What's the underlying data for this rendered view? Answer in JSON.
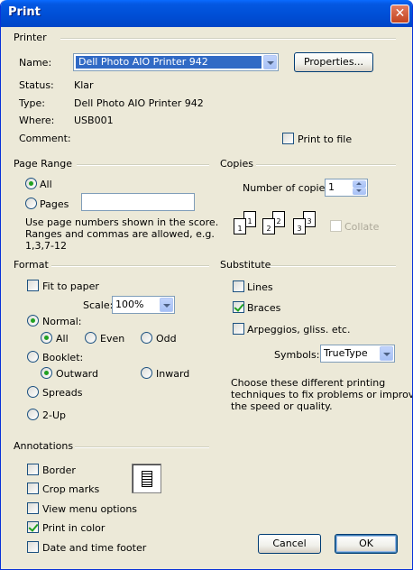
{
  "window": {
    "title": "Print"
  },
  "printer": {
    "group_label": "Printer",
    "name_label": "Name:",
    "name_value": "Dell Photo AIO Printer 942",
    "properties_button": "Properties...",
    "status_label": "Status:",
    "status_value": "Klar",
    "type_label": "Type:",
    "type_value": "Dell Photo AIO Printer 942",
    "where_label": "Where:",
    "where_value": "USB001",
    "comment_label": "Comment:",
    "print_to_file": "Print to file"
  },
  "page_range": {
    "group_label": "Page Range",
    "all": "All",
    "pages": "Pages",
    "hint": [
      "Use page numbers shown in the score.",
      "Ranges and commas are allowed, e.g.",
      "1,3,7-12"
    ]
  },
  "copies": {
    "group_label": "Copies",
    "number_label": "Number of copies:",
    "number_value": "1",
    "collate": "Collate",
    "collate_pages": [
      "1",
      "1",
      "2",
      "2",
      "3",
      "3"
    ]
  },
  "format": {
    "group_label": "Format",
    "fit_to_paper": "Fit to paper",
    "scale_label": "Scale:",
    "scale_value": "100%",
    "normal": "Normal:",
    "normal_all": "All",
    "normal_even": "Even",
    "normal_odd": "Odd",
    "booklet": "Booklet:",
    "outward": "Outward",
    "inward": "Inward",
    "spreads": "Spreads",
    "two_up": "2-Up"
  },
  "substitute": {
    "group_label": "Substitute",
    "lines": "Lines",
    "braces": "Braces",
    "arpeggios": "Arpeggios, gliss. etc.",
    "symbols_label": "Symbols:",
    "symbols_value": "TrueType",
    "hint": [
      "Choose these different printing",
      "techniques to fix problems or improve",
      "the speed or quality."
    ]
  },
  "annotations": {
    "group_label": "Annotations",
    "border": "Border",
    "crop_marks": "Crop marks",
    "view_menu_options": "View menu options",
    "print_in_color": "Print in color",
    "date_time_footer": "Date and time footer"
  },
  "buttons": {
    "cancel": "Cancel",
    "ok": "OK"
  },
  "icons": {
    "close": "close-icon",
    "dropdown": "chevron-down-icon",
    "spinner": "spinner-arrows-icon",
    "annotation_preview": "page-preview-icon"
  }
}
